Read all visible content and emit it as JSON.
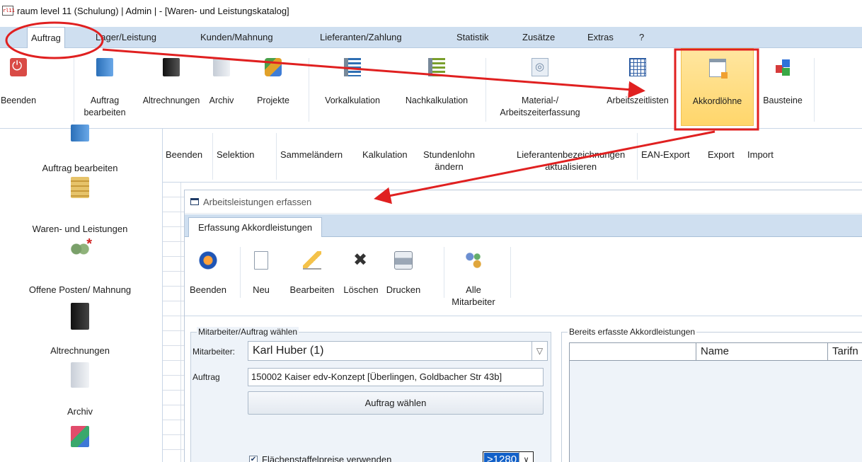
{
  "window": {
    "title": "raum level 11 (Schulung) | Admin | - [Waren- und Leistungskatalog]",
    "app_icon_text": "rl11"
  },
  "menu": {
    "items": [
      "Auftrag",
      "Lager/Leistung",
      "Kunden/Mahnung",
      "Lieferanten/Zahlung",
      "Statistik",
      "Zusätze",
      "Extras",
      "?"
    ],
    "active": "Auftrag"
  },
  "ribbon": {
    "buttons": [
      {
        "label": "Beenden",
        "icon": "power-icon"
      },
      {
        "label": "Auftrag\nbearbeiten",
        "icon": "book-blue-icon"
      },
      {
        "label": "Altrechnungen",
        "icon": "book-black-icon"
      },
      {
        "label": "Archiv",
        "icon": "book-grey-icon"
      },
      {
        "label": "Projekte",
        "icon": "projects-icon"
      },
      {
        "label": "Vorkalkulation",
        "icon": "calc-icon"
      },
      {
        "label": "Nachkalkulation",
        "icon": "calc-icon"
      },
      {
        "label": "Material-/\nArbeitszeiterfassung",
        "icon": "material-icon"
      },
      {
        "label": "Arbeitszeitlisten",
        "icon": "grid-icon"
      },
      {
        "label": "Akkordlöhne",
        "icon": "window-icon"
      },
      {
        "label": "Bausteine",
        "icon": "cubes-icon"
      }
    ],
    "highlighted": "Akkordlöhne"
  },
  "sidebar": {
    "items": [
      "Auftrag bearbeiten",
      "Waren- und Leistungen",
      "Offene Posten/ Mahnung",
      "Altrechnungen",
      "Archiv"
    ]
  },
  "toolbar2": {
    "buttons": [
      "Beenden",
      "Selektion",
      "Sammeländern",
      "Kalkulation",
      "Stundenlohn\nändern",
      "Lieferantenbezeichnungen\naktualisieren",
      "EAN-Export",
      "Export",
      "Import"
    ]
  },
  "dialog": {
    "title": "Arbeitsleistungen erfassen",
    "tab": "Erfassung Akkordleistungen",
    "buttons": [
      {
        "label": "Beenden",
        "icon": "back-icon"
      },
      {
        "label": "Neu",
        "icon": "new-document-icon"
      },
      {
        "label": "Bearbeiten",
        "icon": "pencil-icon"
      },
      {
        "label": "Löschen",
        "icon": "delete-icon"
      },
      {
        "label": "Drucken",
        "icon": "printer-icon"
      },
      {
        "label": "Alle\nMitarbeiter",
        "icon": "users-icon"
      }
    ],
    "left_group": {
      "title": "Mitarbeiter/Auftrag wählen",
      "employee_label": "Mitarbeiter:",
      "employee_value": "Karl Huber (1)",
      "order_label": "Auftrag",
      "order_value": "150002 Kaiser edv-Konzept  [Überlingen, Goldbacher Str 43b]",
      "choose_button": "Auftrag wählen",
      "checkbox_label": "Flächenstaffelpreise verwenden",
      "checkbox_checked": true,
      "staffel_value": ">1280"
    },
    "right_group": {
      "title": "Bereits erfasste Akkordleistungen",
      "columns": [
        "",
        "Name",
        "Tarifn"
      ]
    }
  },
  "colors": {
    "annotation": "#e02020",
    "highlight": "#ffd66b",
    "menubar": "#cfdff0"
  }
}
